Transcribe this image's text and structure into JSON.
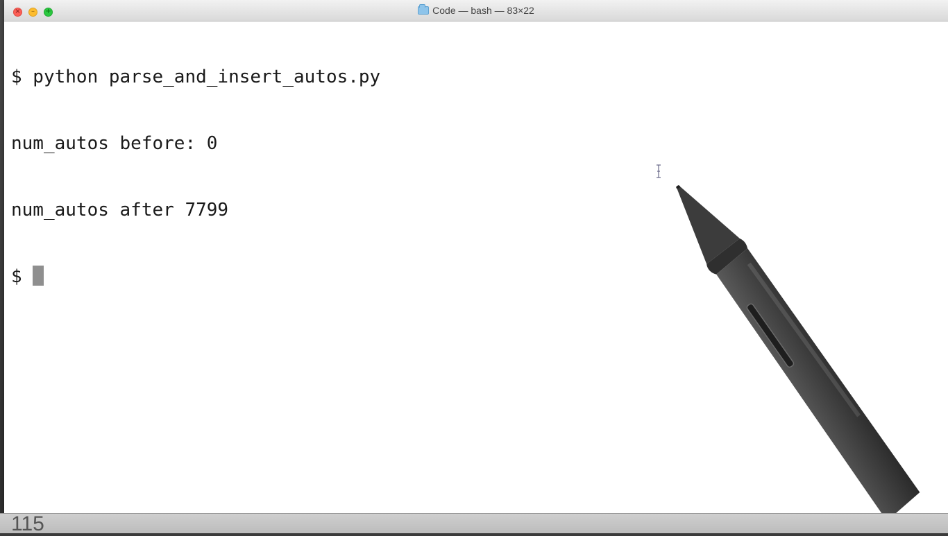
{
  "window": {
    "title": "Code — bash — 83×22",
    "controls": {
      "close_glyph": "×",
      "minimize_glyph": "–",
      "zoom_glyph": "+"
    }
  },
  "terminal": {
    "lines": [
      "$ python parse_and_insert_autos.py",
      "num_autos before: 0",
      "num_autos after 7799"
    ],
    "prompt": "$ "
  },
  "footer": {
    "page_number": "115"
  },
  "icons": {
    "folder": "folder-icon",
    "text_cursor": "ibeam-cursor-icon",
    "stylus": "stylus-pen"
  },
  "colors": {
    "close": "#fc5f57",
    "minimize": "#fdbc2e",
    "zoom": "#2bc840",
    "terminal_bg": "#ffffff",
    "terminal_text": "#1a1a1a",
    "cursor": "#8f8f8f"
  }
}
